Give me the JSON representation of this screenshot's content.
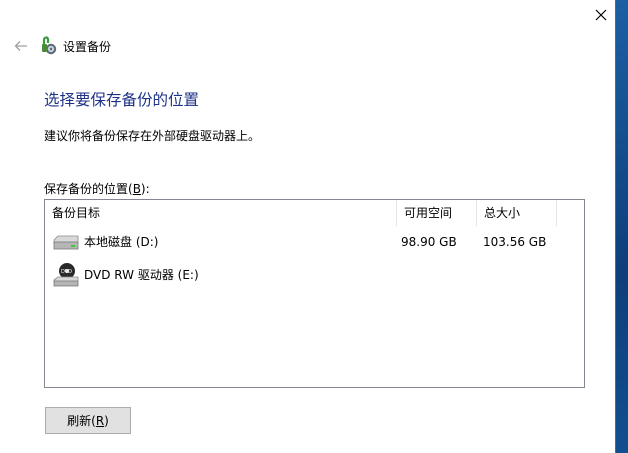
{
  "window": {
    "close_glyph": "✕"
  },
  "nav": {
    "back_glyph": "←",
    "breadcrumb": "设置备份"
  },
  "main": {
    "heading": "选择要保存备份的位置",
    "description": "建议你将备份保存在外部硬盘驱动器上。",
    "list_label_prefix": "保存备份的位置(",
    "list_label_key": "B",
    "list_label_suffix": "):"
  },
  "table": {
    "columns": [
      "备份目标",
      "可用空间",
      "总大小"
    ],
    "rows": [
      {
        "name": "本地磁盘 (D:)",
        "free": "98.90 GB",
        "total": "103.56 GB",
        "icon": "hard-drive-icon"
      },
      {
        "name": "DVD RW 驱动器 (E:)",
        "free": "",
        "total": "",
        "icon": "dvd-drive-icon"
      }
    ]
  },
  "refresh": {
    "prefix": "刷新(",
    "key": "R",
    "suffix": ")"
  },
  "colors": {
    "heading": "#1e3287",
    "accent_strip": "#0d3f7a"
  }
}
